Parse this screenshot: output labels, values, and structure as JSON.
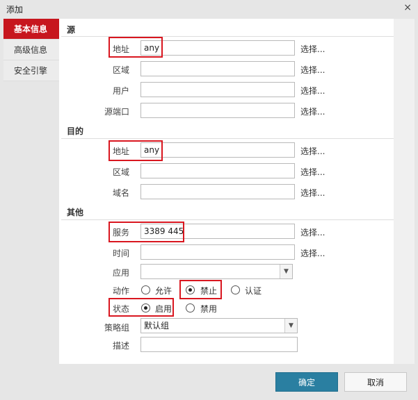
{
  "dialog": {
    "title": "添加",
    "close_icon": "×"
  },
  "sidebar": {
    "items": [
      {
        "label": "基本信息",
        "active": true
      },
      {
        "label": "高级信息",
        "active": false
      },
      {
        "label": "安全引擎",
        "active": false
      }
    ]
  },
  "source": {
    "title": "源",
    "address": {
      "label": "地址",
      "value": "any"
    },
    "zone": {
      "label": "区域",
      "value": ""
    },
    "user": {
      "label": "用户",
      "value": ""
    },
    "port": {
      "label": "源端口",
      "value": ""
    }
  },
  "destination": {
    "title": "目的",
    "address": {
      "label": "地址",
      "value": "any"
    },
    "zone": {
      "label": "区域",
      "value": ""
    },
    "domain": {
      "label": "域名",
      "value": ""
    }
  },
  "other": {
    "title": "其他",
    "service": {
      "label": "服务",
      "value": "3389 445"
    },
    "time": {
      "label": "时间",
      "value": ""
    },
    "app": {
      "label": "应用",
      "value": ""
    },
    "action": {
      "label": "动作",
      "options": [
        "允许",
        "禁止",
        "认证"
      ],
      "selected": "禁止"
    },
    "status": {
      "label": "状态",
      "options": [
        "启用",
        "禁用"
      ],
      "selected": "启用"
    },
    "policy_group": {
      "label": "策略组",
      "value": "默认组"
    },
    "description": {
      "label": "描述",
      "value": ""
    }
  },
  "select_link": "选择...",
  "buttons": {
    "ok": "确定",
    "cancel": "取消"
  },
  "colors": {
    "highlight": "#d9161f",
    "active_tab": "#c7161e",
    "ok_button": "#2a7fa1"
  }
}
